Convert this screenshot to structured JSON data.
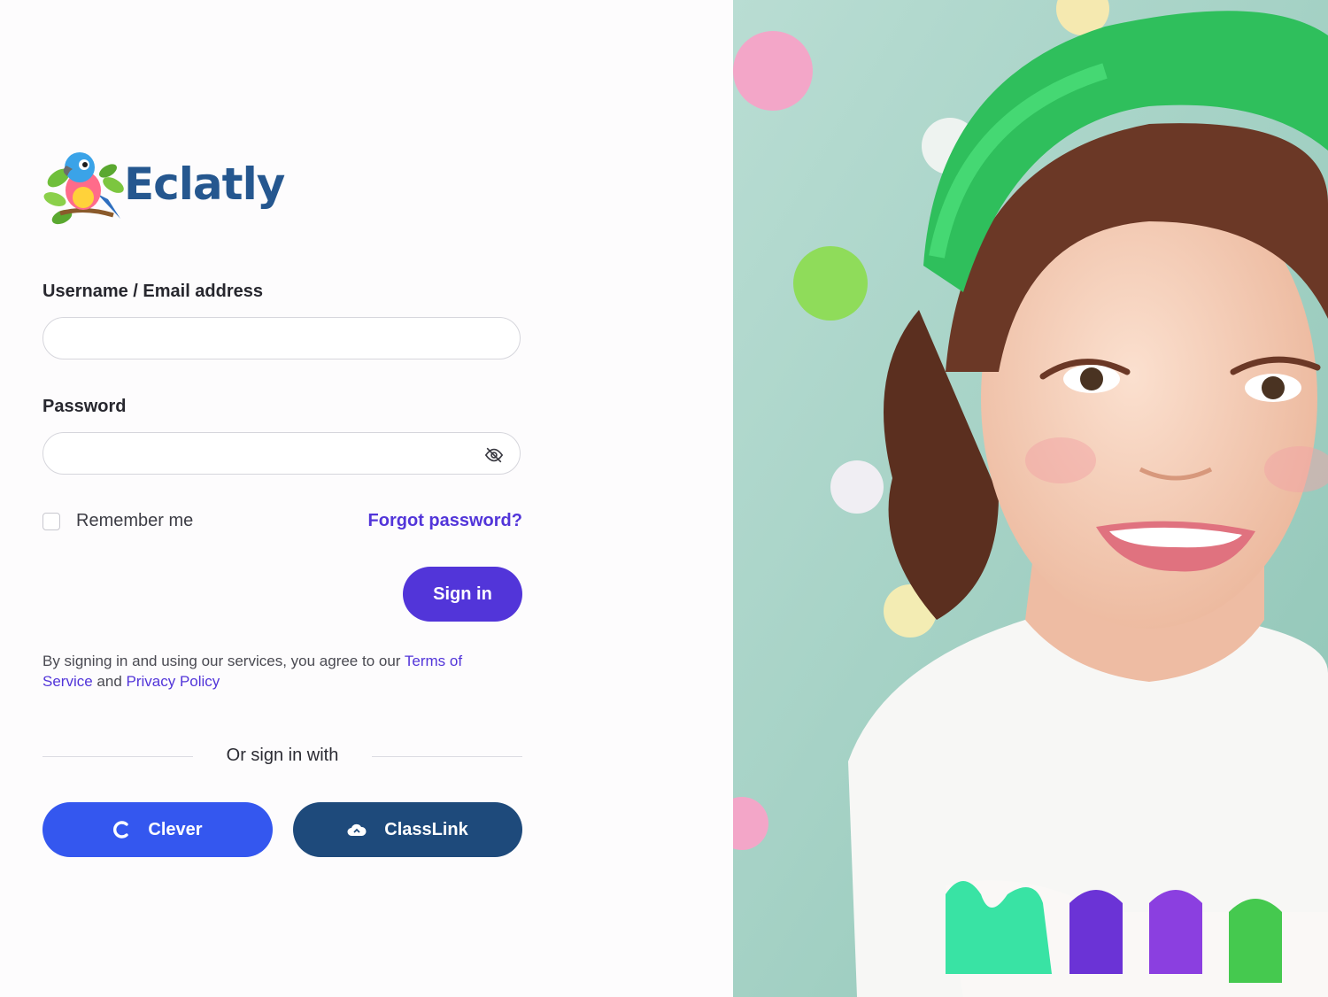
{
  "brand": {
    "name": "Eclatly",
    "color": "#25578f"
  },
  "form": {
    "username_label": "Username / Email address",
    "username_value": "",
    "password_label": "Password",
    "password_value": "",
    "remember_label": "Remember me",
    "remember_checked": false,
    "forgot_label": "Forgot password?",
    "signin_label": "Sign in"
  },
  "terms": {
    "prefix": "By signing in and using our services, you agree to our ",
    "tos_link": "Terms of Service",
    "and": " and ",
    "privacy_link": "Privacy Policy"
  },
  "sso": {
    "divider_label": "Or sign in with",
    "clever_label": "Clever",
    "classlink_label": "ClassLink"
  },
  "icons": {
    "eye": "eye-off-icon",
    "clever": "clever-c-icon",
    "classlink": "classlink-cloud-icon"
  },
  "colors": {
    "accent": "#5235d9",
    "clever": "#3457ef",
    "classlink": "#1e4a7b",
    "photo_background": "#a9d6c8",
    "hat": "#2bbf5a"
  }
}
